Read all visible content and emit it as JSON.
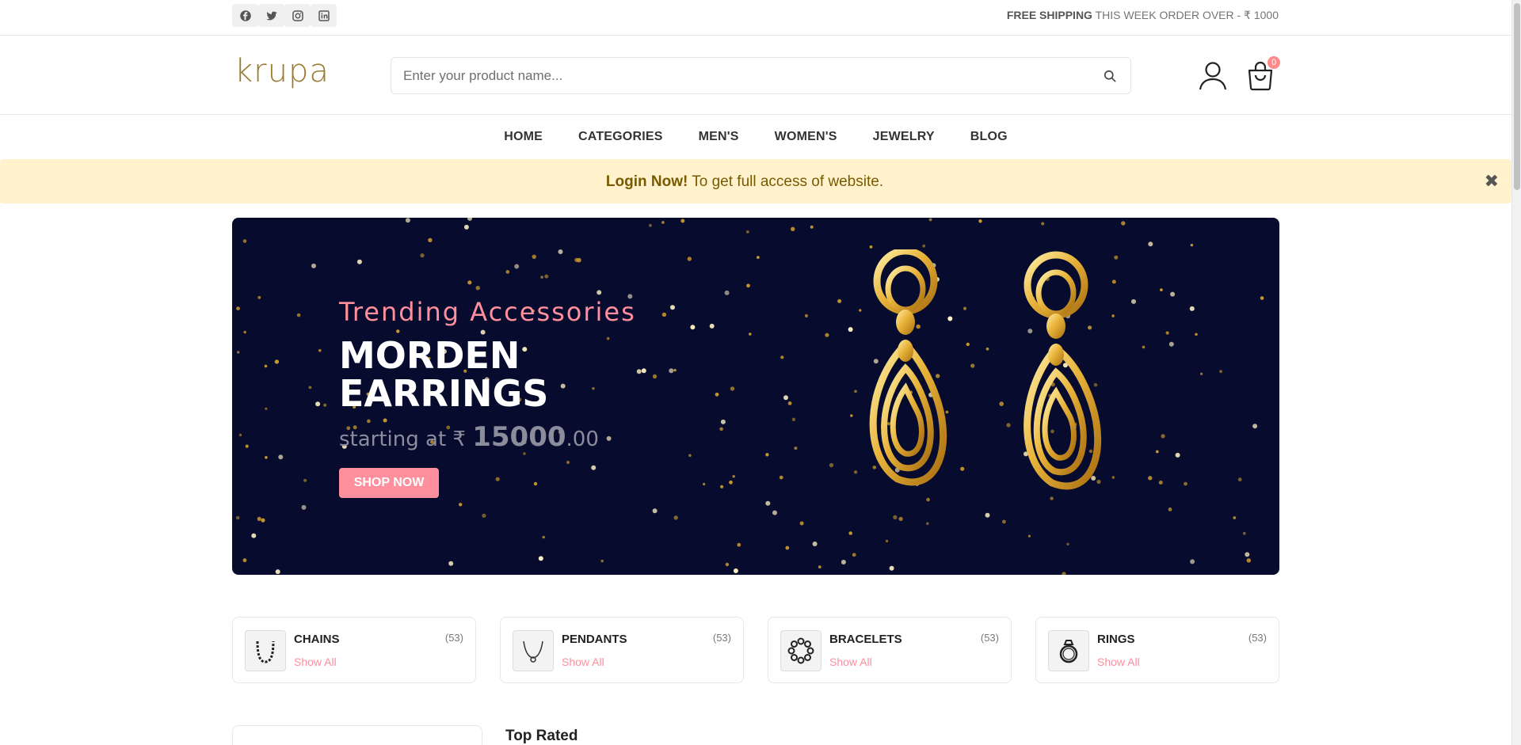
{
  "topbar": {
    "socials": [
      "facebook-icon",
      "twitter-icon",
      "instagram-icon",
      "linkedin-icon"
    ],
    "shipping_bold": "FREE SHIPPING",
    "shipping_rest": "THIS WEEK ORDER OVER - ₹ 1000"
  },
  "header": {
    "logo": "krupa",
    "search_placeholder": "Enter your product name...",
    "cart_count": "0"
  },
  "nav": {
    "items": [
      "HOME",
      "CATEGORIES",
      "MEN'S",
      "WOMEN'S",
      "JEWELRY",
      "BLOG"
    ]
  },
  "alert": {
    "bold": "Login Now!",
    "text": " To get full access of website.",
    "close": "✖"
  },
  "hero": {
    "subtitle": "Trending Accessories",
    "title": "MORDEN EARRINGS",
    "price_prefix": "starting at ₹ ",
    "price_big": "15000",
    "price_decimal": ".00",
    "button": "SHOP NOW"
  },
  "categories": [
    {
      "name": "CHAINS",
      "count": "(53)",
      "link": "Show All",
      "icon": "chain-icon"
    },
    {
      "name": "PENDANTS",
      "count": "(53)",
      "link": "Show All",
      "icon": "pendant-icon"
    },
    {
      "name": "BRACELETS",
      "count": "(53)",
      "link": "Show All",
      "icon": "bracelet-icon"
    },
    {
      "name": "RINGS",
      "count": "(53)",
      "link": "Show All",
      "icon": "ring-icon"
    }
  ],
  "sections": {
    "top_rated": "Top Rated"
  },
  "colors": {
    "accent": "#ff8f9c",
    "hero_bg": "#070b2e",
    "alert_bg": "#fff2cd",
    "logo": "#9a7a2e"
  }
}
